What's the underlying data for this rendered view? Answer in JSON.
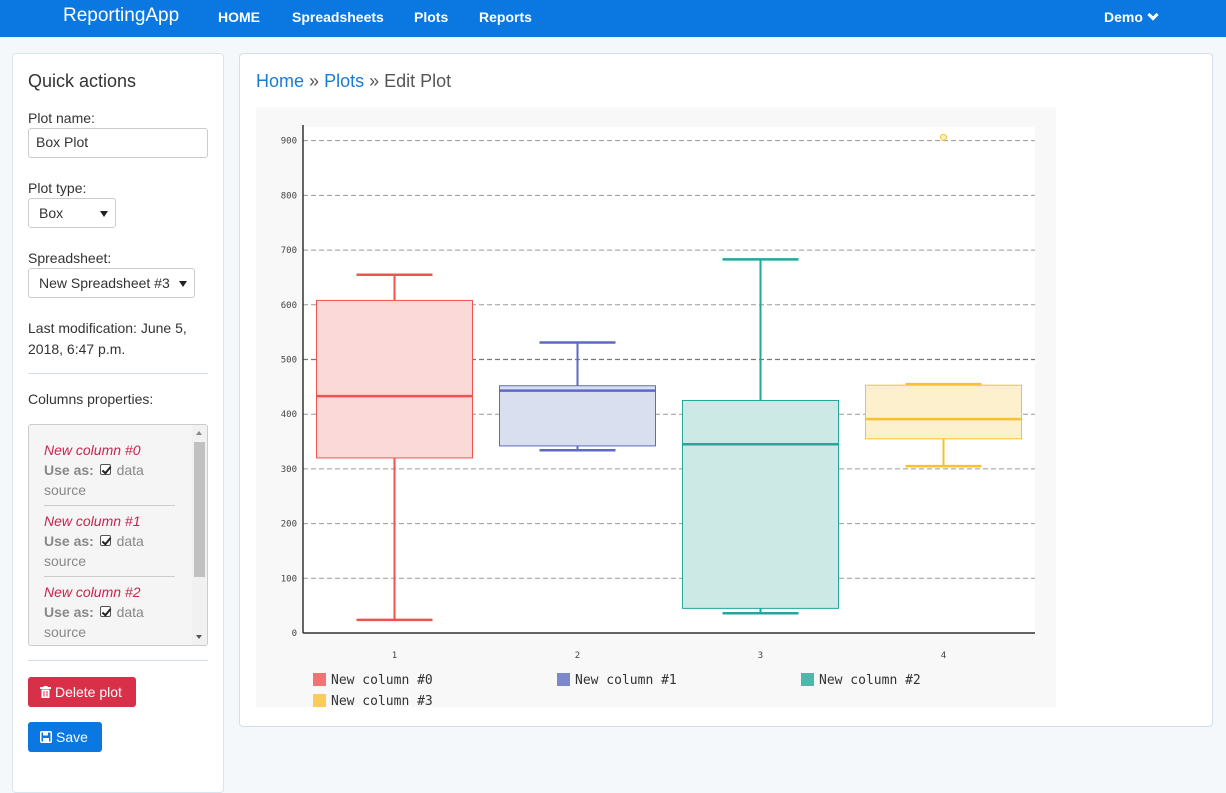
{
  "navbar": {
    "brand": "ReportingApp",
    "links": [
      "HOME",
      "Spreadsheets",
      "Plots",
      "Reports"
    ],
    "user": "Demo",
    "color": "#0a78e0"
  },
  "sidebar": {
    "title": "Quick actions",
    "plot_name_label": "Plot name:",
    "plot_name_value": "Box Plot",
    "plot_type_label": "Plot type:",
    "plot_type_value": "Box",
    "spreadsheet_label": "Spreadsheet:",
    "spreadsheet_value": "New Spreadsheet #3",
    "last_modification": "Last modification: June 5, 2018, 6:47 p.m.",
    "columns_label": "Columns properties:",
    "columns": [
      {
        "name": "New column #0",
        "use_as": "Use as:",
        "role": "data source"
      },
      {
        "name": "New column #1",
        "use_as": "Use as:",
        "role": "data source"
      },
      {
        "name": "New column #2",
        "use_as": "Use as:",
        "role": "data source"
      }
    ],
    "delete_label": "Delete plot",
    "save_label": "Save"
  },
  "breadcrumb": {
    "home": "Home",
    "plots": "Plots",
    "current": "Edit Plot",
    "separator": "»"
  },
  "chart_data": {
    "type": "box",
    "x_tick_labels": [
      "1",
      "2",
      "3",
      "4"
    ],
    "ylim": [
      0,
      925
    ],
    "y_ticks": [
      0,
      100,
      200,
      300,
      400,
      500,
      600,
      700,
      800,
      900
    ],
    "grid": true,
    "legend_position": "bottom",
    "series": [
      {
        "name": "New column #0",
        "color": "#ef5350",
        "fill": "#fbd9d8",
        "whisker_low": 24,
        "q1": 320,
        "median": 433,
        "q3": 608,
        "whisker_high": 655,
        "outliers": []
      },
      {
        "name": "New column #1",
        "color": "#5c6bc0",
        "fill": "#dadff0",
        "whisker_low": 334,
        "q1": 342,
        "median": 443,
        "q3": 452,
        "whisker_high": 531,
        "outliers": []
      },
      {
        "name": "New column #2",
        "color": "#26a69a",
        "fill": "#cce9e6",
        "whisker_low": 36,
        "q1": 45,
        "median": 345,
        "q3": 425,
        "whisker_high": 683,
        "outliers": []
      },
      {
        "name": "New column #3",
        "color": "#fbc02d",
        "fill": "#fdf0cc",
        "whisker_low": 305,
        "q1": 355,
        "median": 391,
        "q3": 453,
        "whisker_high": 455,
        "outliers": [
          906
        ]
      }
    ]
  }
}
